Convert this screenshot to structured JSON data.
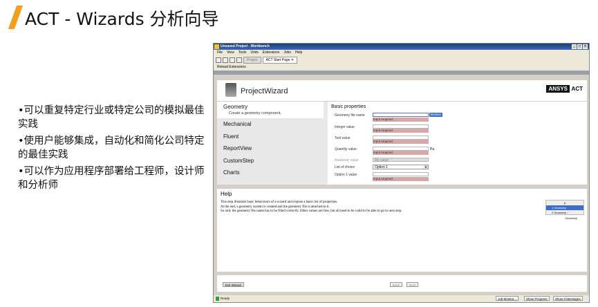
{
  "slide": {
    "title": "ACT - Wizards 分析向导",
    "bullets": [
      "•可以重复特定行业或特定公司的模拟最佳实践",
      "•使用户能够集成，自动化和简化公司特定的最佳实践",
      "•可以作为应用程序部署给工程师，设计师和分析师"
    ]
  },
  "window": {
    "title": "Unsaved Project - Workbench",
    "controls": [
      "_",
      "□",
      "×"
    ],
    "menu": [
      "File",
      "View",
      "Tools",
      "Units",
      "Extensions",
      "Jobs",
      "Help"
    ],
    "tabs": [
      {
        "label": "Project"
      },
      {
        "label": "ACT Start Page"
      }
    ],
    "tab_close": "✕",
    "toolbar": {
      "reload": "Reload Extensions"
    }
  },
  "wizard": {
    "title": "ProjectWizard",
    "brand": "ANSYS",
    "brand_suffix": "ACT",
    "steps": [
      {
        "label": "Geometry",
        "desc": "Create a geometry component."
      },
      {
        "label": "Mechanical"
      },
      {
        "label": "Fluent"
      },
      {
        "label": "ReportView"
      },
      {
        "label": "CustomStep"
      },
      {
        "label": "Charts"
      }
    ],
    "properties": {
      "heading": "Basic properties",
      "geometry_label": "Geometry file name",
      "browse": "Browse",
      "input_required": "Input required.",
      "integer_label": "Integer value",
      "text_label": "Text value",
      "quantity_label": "Quantity value",
      "quantity_unit": "Pa",
      "readonly_label": "Readonly value",
      "readonly_value": "My value",
      "list_label": "List of choice",
      "list_value": "Option 1",
      "option_label": "Option 1 value"
    },
    "help": {
      "heading": "Help",
      "lines": [
        "This step illustrate basic behaviours of a wizard and expose a basic list of properties.",
        "At the end, a geometry system is created and the geometry file is attached to it.",
        "So only the geometry file name has to be filled correctly. Other values are free, but all need to be valid to be able to go to next step."
      ],
      "schematic": {
        "header": "A",
        "rows": [
          {
            "num": "1",
            "label": "Geometry"
          },
          {
            "num": "2",
            "label": "Geometry"
          }
        ],
        "caption": "Geometry"
      }
    },
    "footer": {
      "exit": "Exit Wizard",
      "back": "Back",
      "next": "Next"
    }
  },
  "status": {
    "text": "Ready",
    "job_monitor": "Job Monitor...",
    "show_progress": "Show Progress",
    "messages": "Show 0 Messages"
  }
}
